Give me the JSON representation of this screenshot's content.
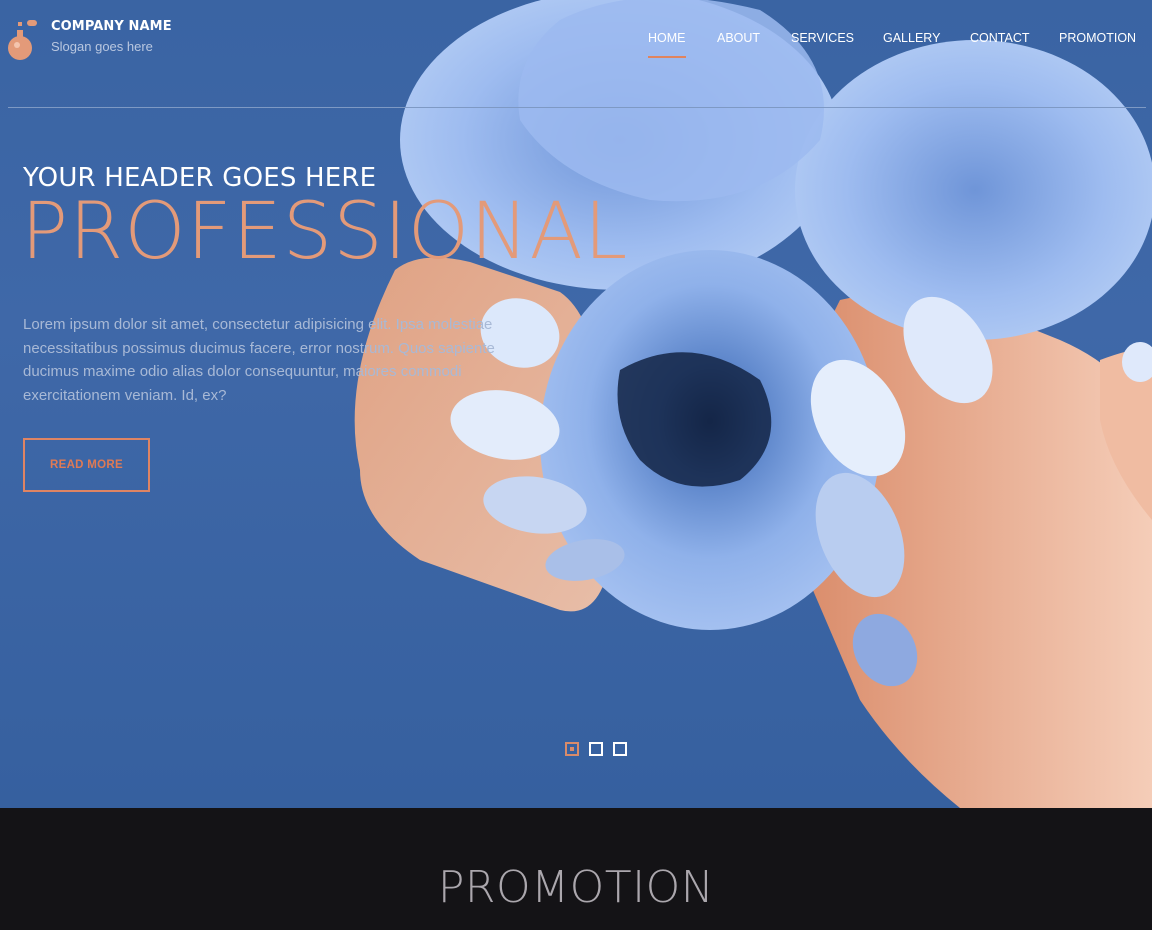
{
  "brand": {
    "name": "COMPANY NAME",
    "slogan": "Slogan goes here",
    "logo_icon": "perfume-bottle-icon"
  },
  "nav": {
    "items": [
      {
        "label": "HOME",
        "active": true
      },
      {
        "label": "ABOUT",
        "active": false
      },
      {
        "label": "SERVICES",
        "active": false
      },
      {
        "label": "GALLERY",
        "active": false
      },
      {
        "label": "CONTACT",
        "active": false
      },
      {
        "label": "PROMOTION",
        "active": false
      }
    ]
  },
  "hero": {
    "kicker": "YOUR HEADER GOES HERE",
    "headline": "PROFESSIONAL",
    "body": "Lorem ipsum dolor sit amet, consectetur adipisicing elit. Ipsa molestiae necessitatibus possimus ducimus facere, error nostrum. Quos sapiente ducimus maxime odio alias dolor consequuntur, maiores commodi exercitationem veniam. Id, ex?",
    "cta_label": "READ MORE",
    "slides": [
      {
        "active": true
      },
      {
        "active": false
      },
      {
        "active": false
      }
    ]
  },
  "promotion": {
    "title": "PROMOTION"
  },
  "colors": {
    "accent": "#e39a79",
    "hero_blue": "#3f68a8",
    "dark": "#141316"
  }
}
